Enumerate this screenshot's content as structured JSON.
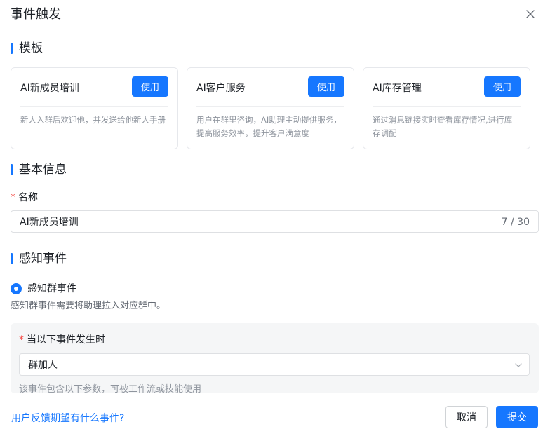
{
  "dialog": {
    "title": "事件触发",
    "close_icon": "close-icon"
  },
  "templates_section": {
    "heading": "模板",
    "cards": [
      {
        "title": "AI新成员培训",
        "button": "使用",
        "description": "新人入群后欢迎他，并发送给他新人手册"
      },
      {
        "title": "AI客户服务",
        "button": "使用",
        "description": "用户在群里咨询，AI助理主动提供服务，提高服务效率，提升客户满意度"
      },
      {
        "title": "AI库存管理",
        "button": "使用",
        "description": "通过消息链接实时查看库存情况,进行库存调配"
      }
    ]
  },
  "basic_info": {
    "heading": "基本信息",
    "name_label": "名称",
    "required_mark": "*",
    "name_value": "AI新成员培训",
    "name_count": "7 / 30"
  },
  "perception": {
    "heading": "感知事件",
    "radio_label": "感知群事件",
    "hint": "感知群事件需要将助理拉入对应群中。",
    "trigger_label": "当以下事件发生时",
    "required_mark": "*",
    "select_value": "群加人",
    "note": "该事件包含以下参数，可被工作流或技能使用"
  },
  "footer": {
    "feedback_link": "用户反馈期望有什么事件?",
    "cancel": "取消",
    "submit": "提交"
  },
  "colors": {
    "accent": "#1677ff",
    "required": "#f54a45"
  }
}
